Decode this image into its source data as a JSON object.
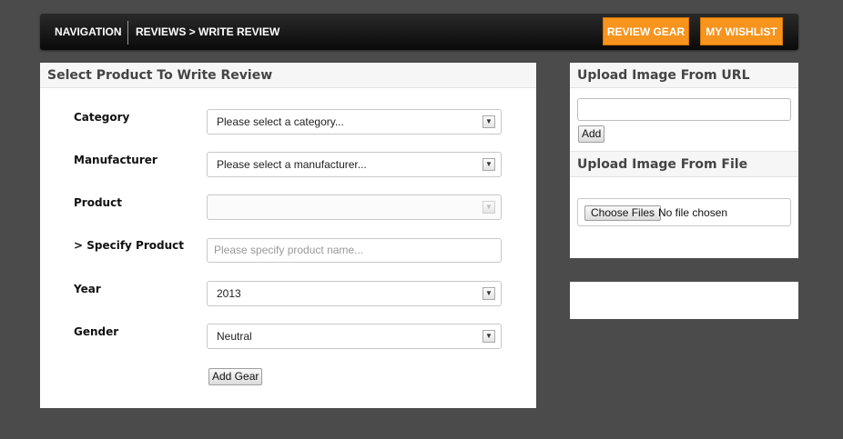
{
  "nav": {
    "title": "NAVIGATION",
    "breadcrumb": "REVIEWS > WRITE REVIEW",
    "review_gear": "REVIEW GEAR",
    "wishlist": "MY WISHLIST",
    "accent_color": "#f7941d"
  },
  "main_panel": {
    "header": "Select Product To Write Review",
    "fields": {
      "category": {
        "label": "Category",
        "value": "Please select a category..."
      },
      "manufacturer": {
        "label": "Manufacturer",
        "value": "Please select a manufacturer..."
      },
      "product": {
        "label": "Product",
        "value": ""
      },
      "specify": {
        "label": "> Specify Product",
        "placeholder": "Please specify product name..."
      },
      "year": {
        "label": "Year",
        "value": "2013"
      },
      "gender": {
        "label": "Gender",
        "value": "Neutral"
      }
    },
    "add_gear": "Add Gear"
  },
  "upload_panel": {
    "url_header": "Upload Image From URL",
    "add_label": "Add",
    "file_header": "Upload Image From File",
    "choose_files": "Choose Files",
    "no_file": "No file chosen"
  }
}
